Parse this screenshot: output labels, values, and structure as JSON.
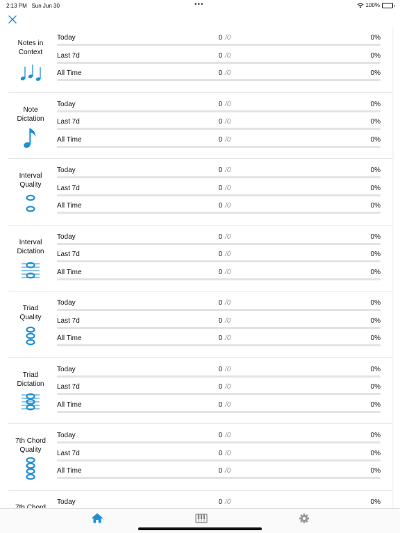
{
  "status_bar": {
    "time": "2:13 PM",
    "date": "Sun Jun 30",
    "battery": "100%"
  },
  "accent_color": "#1e8fd5",
  "exercises": [
    {
      "name": "Notes in\nContext",
      "icon": "notes-in-context-icon",
      "rows": [
        {
          "label": "Today",
          "count": "0",
          "total": "/0",
          "percent": "0%",
          "progress": 0
        },
        {
          "label": "Last 7d",
          "count": "0",
          "total": "/0",
          "percent": "0%",
          "progress": 0
        },
        {
          "label": "All Time",
          "count": "0",
          "total": "/0",
          "percent": "0%",
          "progress": 0
        }
      ]
    },
    {
      "name": "Note\nDictation",
      "icon": "note-dictation-icon",
      "rows": [
        {
          "label": "Today",
          "count": "0",
          "total": "/0",
          "percent": "0%",
          "progress": 0
        },
        {
          "label": "Last 7d",
          "count": "0",
          "total": "/0",
          "percent": "0%",
          "progress": 0
        },
        {
          "label": "All Time",
          "count": "0",
          "total": "/0",
          "percent": "0%",
          "progress": 0
        }
      ]
    },
    {
      "name": "Interval\nQuality",
      "icon": "interval-quality-icon",
      "rows": [
        {
          "label": "Today",
          "count": "0",
          "total": "/0",
          "percent": "0%",
          "progress": 0
        },
        {
          "label": "Last 7d",
          "count": "0",
          "total": "/0",
          "percent": "0%",
          "progress": 0
        },
        {
          "label": "All Time",
          "count": "0",
          "total": "/0",
          "percent": "0%",
          "progress": 0
        }
      ]
    },
    {
      "name": "Interval\nDictation",
      "icon": "interval-dictation-icon",
      "rows": [
        {
          "label": "Today",
          "count": "0",
          "total": "/0",
          "percent": "0%",
          "progress": 0
        },
        {
          "label": "Last 7d",
          "count": "0",
          "total": "/0",
          "percent": "0%",
          "progress": 0
        },
        {
          "label": "All Time",
          "count": "0",
          "total": "/0",
          "percent": "0%",
          "progress": 0
        }
      ]
    },
    {
      "name": "Triad\nQuality",
      "icon": "triad-quality-icon",
      "rows": [
        {
          "label": "Today",
          "count": "0",
          "total": "/0",
          "percent": "0%",
          "progress": 0
        },
        {
          "label": "Last 7d",
          "count": "0",
          "total": "/0",
          "percent": "0%",
          "progress": 0
        },
        {
          "label": "All Time",
          "count": "0",
          "total": "/0",
          "percent": "0%",
          "progress": 0
        }
      ]
    },
    {
      "name": "Triad\nDictation",
      "icon": "triad-dictation-icon",
      "rows": [
        {
          "label": "Today",
          "count": "0",
          "total": "/0",
          "percent": "0%",
          "progress": 0
        },
        {
          "label": "Last 7d",
          "count": "0",
          "total": "/0",
          "percent": "0%",
          "progress": 0
        },
        {
          "label": "All Time",
          "count": "0",
          "total": "/0",
          "percent": "0%",
          "progress": 0
        }
      ]
    },
    {
      "name": "7th Chord\nQuality",
      "icon": "seventh-chord-quality-icon",
      "rows": [
        {
          "label": "Today",
          "count": "0",
          "total": "/0",
          "percent": "0%",
          "progress": 0
        },
        {
          "label": "Last 7d",
          "count": "0",
          "total": "/0",
          "percent": "0%",
          "progress": 0
        },
        {
          "label": "All Time",
          "count": "0",
          "total": "/0",
          "percent": "0%",
          "progress": 0
        }
      ]
    },
    {
      "name": "7th Chord",
      "icon": "seventh-chord-dictation-icon",
      "rows": [
        {
          "label": "Today",
          "count": "0",
          "total": "/0",
          "percent": "0%",
          "progress": 0
        }
      ]
    }
  ],
  "tabs": [
    {
      "icon": "home-icon",
      "active": true
    },
    {
      "icon": "piano-icon",
      "active": false
    },
    {
      "icon": "gear-icon",
      "active": false
    }
  ]
}
